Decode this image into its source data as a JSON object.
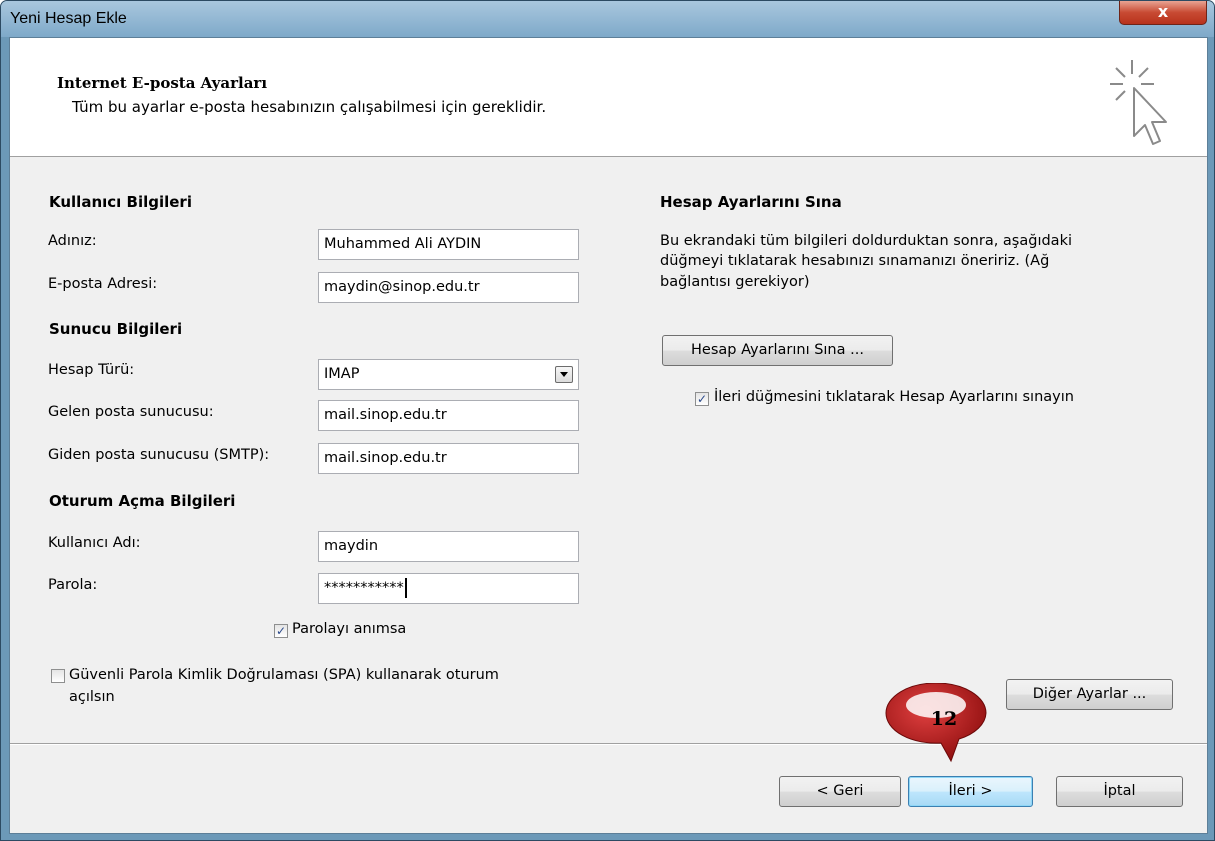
{
  "window": {
    "title": "Yeni Hesap Ekle",
    "close_glyph": "x"
  },
  "header": {
    "title": "Internet E-posta Ayarları",
    "subtitle": "Tüm bu ayarlar e-posta hesabınızın çalışabilmesi için gereklidir.",
    "icon": "cursor-click-icon"
  },
  "user_info": {
    "heading": "Kullanıcı Bilgileri",
    "name_label": "Adınız:",
    "name_value": "Muhammed Ali AYDIN",
    "email_label": "E-posta Adresi:",
    "email_value": "maydin@sinop.edu.tr"
  },
  "server_info": {
    "heading": "Sunucu Bilgileri",
    "account_type_label": "Hesap Türü:",
    "account_type_value": "IMAP",
    "incoming_label": "Gelen posta sunucusu:",
    "incoming_value": "mail.sinop.edu.tr",
    "outgoing_label": "Giden posta sunucusu (SMTP):",
    "outgoing_value": "mail.sinop.edu.tr"
  },
  "logon_info": {
    "heading": "Oturum Açma Bilgileri",
    "username_label": "Kullanıcı Adı:",
    "username_value": "maydin",
    "password_label": "Parola:",
    "password_value": "***********",
    "remember_label": "Parolayı anımsa",
    "remember_checked": true,
    "spa_label_line1": "Güvenli Parola Kimlik Doğrulaması (SPA) kullanarak oturum",
    "spa_label_line2": "açılsın",
    "spa_checked": false
  },
  "test_settings": {
    "heading": "Hesap Ayarlarını Sına",
    "description_line1": "Bu ekrandaki tüm bilgileri doldurduktan sonra, aşağıdaki",
    "description_line2": "düğmeyi tıklatarak hesabınızı sınamanızı öneririz. (Ağ",
    "description_line3": "bağlantısı gerekiyor)",
    "test_button": "Hesap Ayarlarını Sına ...",
    "auto_test_label": "İleri düğmesini tıklatarak Hesap Ayarlarını sınayın",
    "auto_test_checked": true,
    "more_settings_button": "Diğer Ayarlar ..."
  },
  "footer": {
    "back_button": "< Geri",
    "next_button": "İleri >",
    "cancel_button": "İptal"
  },
  "callout": {
    "number": "12",
    "color": "#c21a1a"
  },
  "colors": {
    "dialog_bg": "#f0f0f0",
    "titlebar": "#8fb4d2",
    "close_button": "#c84a33"
  }
}
